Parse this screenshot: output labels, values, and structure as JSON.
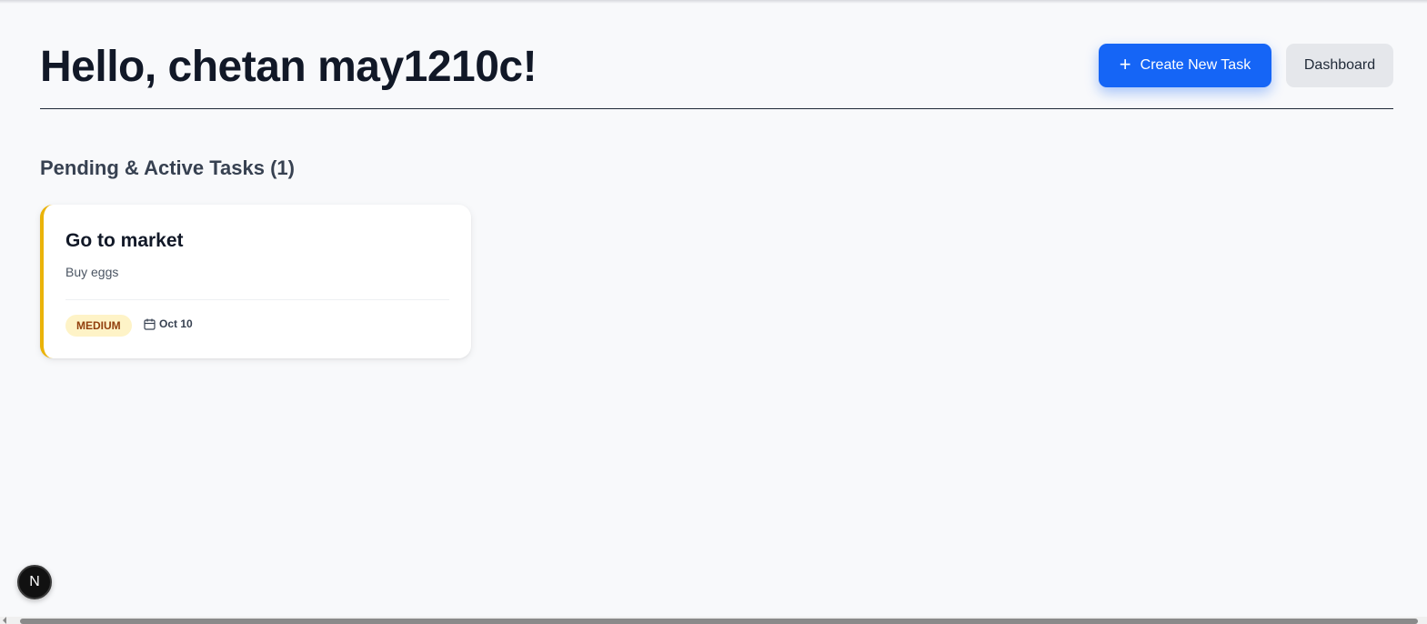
{
  "header": {
    "greeting": "Hello, chetan may1210c!",
    "create_button_icon": "plus-icon",
    "create_button_label": "Create New Task",
    "dashboard_button_label": "Dashboard"
  },
  "tasks_section": {
    "title": "Pending & Active Tasks (1)",
    "tasks": [
      {
        "title": "Go to market",
        "description": "Buy eggs",
        "priority": "MEDIUM",
        "due_icon": "calendar-icon",
        "due_date": "Oct 10"
      }
    ]
  },
  "dev_badge": {
    "label": "N"
  },
  "colors": {
    "accent": "#1565f6",
    "priority_medium_border": "#eab308",
    "priority_medium_bg": "#fef3c7",
    "priority_medium_text": "#92400e"
  }
}
